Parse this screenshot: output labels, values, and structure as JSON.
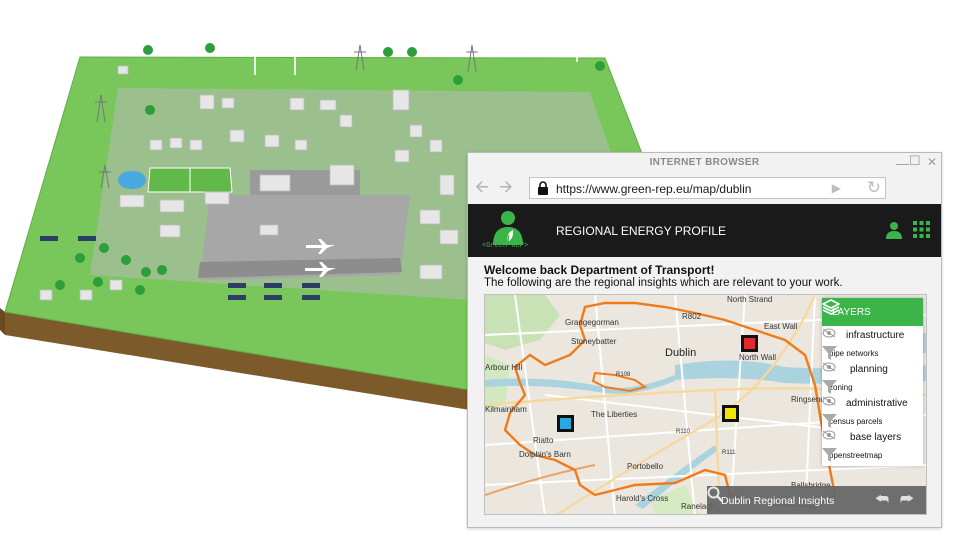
{
  "browser": {
    "window_title": "INTERNET BROWSER",
    "url": "https://www.green-rep.eu/map/dublin",
    "icons": [
      "back-arrow-icon",
      "forward-arrow-icon",
      "lock-icon",
      "go-icon",
      "reload-icon",
      "minimize-icon",
      "maximize-icon",
      "close-icon"
    ]
  },
  "app": {
    "logo_text": "<Green-REP>",
    "title": "REGIONAL ENERGY PROFILE",
    "accent_color": "#3bb54a",
    "header_color": "#1a1a1a",
    "icons": [
      "user-icon",
      "apps-grid-icon"
    ]
  },
  "page": {
    "welcome": "Welcome back Department of Transport!",
    "subtitle": "The following are the regional insights which are relevant to your work."
  },
  "map": {
    "labels": {
      "north_strand": "North Strand",
      "grangegorman": "Grangegorman",
      "r802": "R802",
      "east_wall": "East Wall",
      "stoneybatter": "Stoneybatter",
      "dublin": "Dublin",
      "north_wall": "North Wall",
      "arbour_hill": "Arbour Hill",
      "r108": "R108",
      "ringsend": "Ringsend",
      "kilmainham": "Kilmainham",
      "the_liberties": "The Liberties",
      "r110": "R110",
      "rialto": "Rialto",
      "dolphins_barn": "Dolphin's Barn",
      "r111": "R111",
      "portobello": "Portobello",
      "ballsbridge": "Ballsbridge",
      "harolds_cross": "Harold's Cross",
      "ranelagh": "Ranelagh"
    },
    "markers": [
      {
        "color": "#e8262b"
      },
      {
        "color": "#f2e600"
      },
      {
        "color": "#29a9e1"
      }
    ],
    "layers_panel": {
      "title": "LAYERS",
      "groups": [
        {
          "name": "infrastructure",
          "sub": "pipe networks"
        },
        {
          "name": "planning",
          "sub": "zoning"
        },
        {
          "name": "administrative",
          "sub": "census parcels"
        },
        {
          "name": "base layers",
          "sub": "openstreetmap"
        }
      ]
    },
    "insights_bar": {
      "label": "Dublin Regional Insights",
      "icons": [
        "search-icon",
        "undo-icon",
        "redo-icon"
      ]
    }
  }
}
